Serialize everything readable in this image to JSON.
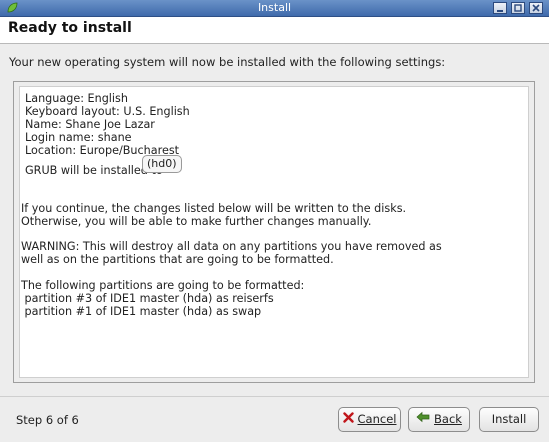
{
  "window": {
    "title": "Install",
    "controls": [
      "minimize",
      "maximize",
      "close"
    ]
  },
  "page": {
    "heading": "Ready to install",
    "intro": "Your new operating system will now be installed with the following settings:"
  },
  "summary": {
    "settings": [
      "Language: English",
      "Keyboard layout: U.S. English",
      "Name: Shane Joe Lazar",
      "Login name: shane",
      "Location: Europe/Bucharest"
    ],
    "grub_label": "GRUB will be installed to",
    "grub_target": "(hd0)",
    "continue_notice": [
      "If you continue, the changes listed below will be written to the disks.",
      "Otherwise, you will be able to make further changes manually."
    ],
    "warning": [
      "WARNING: This will destroy all data on any partitions you have removed as",
      "well as on the partitions that are going to be formatted."
    ],
    "format_heading": "The following partitions are going to be formatted:",
    "partitions": [
      " partition #3 of IDE1 master (hda) as reiserfs",
      " partition #1 of IDE1 master (hda) as swap"
    ]
  },
  "footer": {
    "step": "Step 6 of 6",
    "cancel_label": "Cancel",
    "back_label": "Back",
    "install_label": "Install"
  },
  "colors": {
    "titlebar": "#3f6aab",
    "cancel_icon": "#c0161b",
    "back_icon": "#4e8f2b"
  }
}
